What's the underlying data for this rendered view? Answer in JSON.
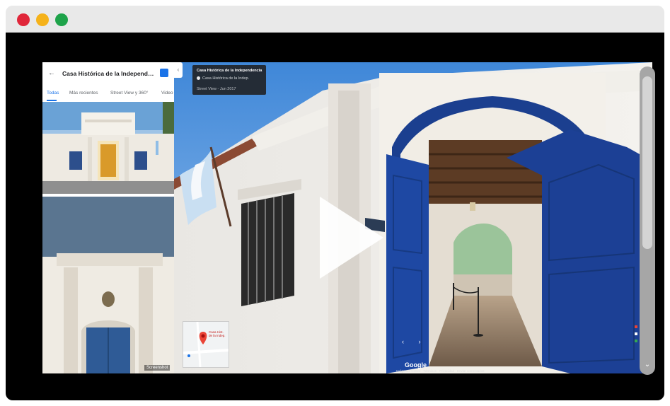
{
  "window": {
    "controls": [
      "close",
      "minimize",
      "maximize"
    ]
  },
  "panel": {
    "title": "Casa Histórica de la Independen...",
    "back_icon": "arrow-left-icon",
    "tabs": [
      "Todas",
      "Más recientes",
      "Street View y 360°",
      "Video"
    ],
    "active_tab": "Todas",
    "collapse_icon": "chevron-left-icon",
    "screenshot_label": "Screenshot"
  },
  "streetview": {
    "infocard_title": "Casa Histórica de la Independencia",
    "infocard_subtitle": "Casa Histórica de la Indep.",
    "infocard_date": "Street View - Jun 2017",
    "watermark": "Google",
    "footer": "Imágenes ©2024 · Términos · Privacidad · Enviar comentarios",
    "close_icon": "close-icon",
    "minimap_label": "Casa Histórica de la Independencia"
  },
  "player": {
    "play_icon": "play-icon"
  },
  "colors": {
    "close_dot": "#e0263a",
    "minimize_dot": "#f5b21a",
    "maximize_dot": "#1ea34a",
    "accent": "#1a73e8",
    "door_blue": "#1b3f8f"
  }
}
